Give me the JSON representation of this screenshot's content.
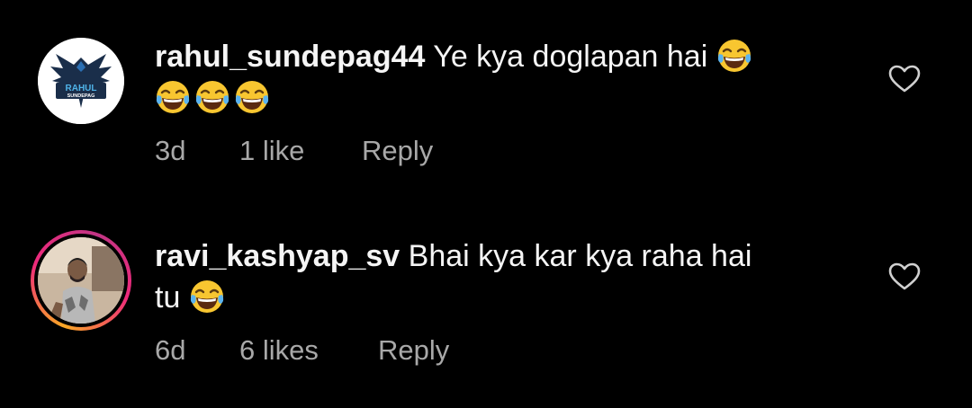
{
  "comments": [
    {
      "username": "rahul_sundepag44",
      "text_line1": "Ye kya doglapan hai",
      "avatar_text_top": "RAHUL",
      "avatar_text_bottom": "SUNDEPAG",
      "age": "3d",
      "likes": "1 like",
      "reply": "Reply",
      "avatar_icon": "eagle-logo-avatar",
      "emoji": "face-with-tears-of-joy"
    },
    {
      "username": "ravi_kashyap_sv",
      "text_line1": "Bhai kya kar kya raha hai",
      "text_line2": "tu",
      "age": "6d",
      "likes": "6 likes",
      "reply": "Reply",
      "avatar_icon": "profile-photo-avatar",
      "emoji": "face-with-tears-of-joy"
    }
  ],
  "colors": {
    "background": "#000000",
    "primary_text": "#f5f5f5",
    "secondary_text": "#a8a8a8",
    "story_ring": "#ee2a7b"
  }
}
